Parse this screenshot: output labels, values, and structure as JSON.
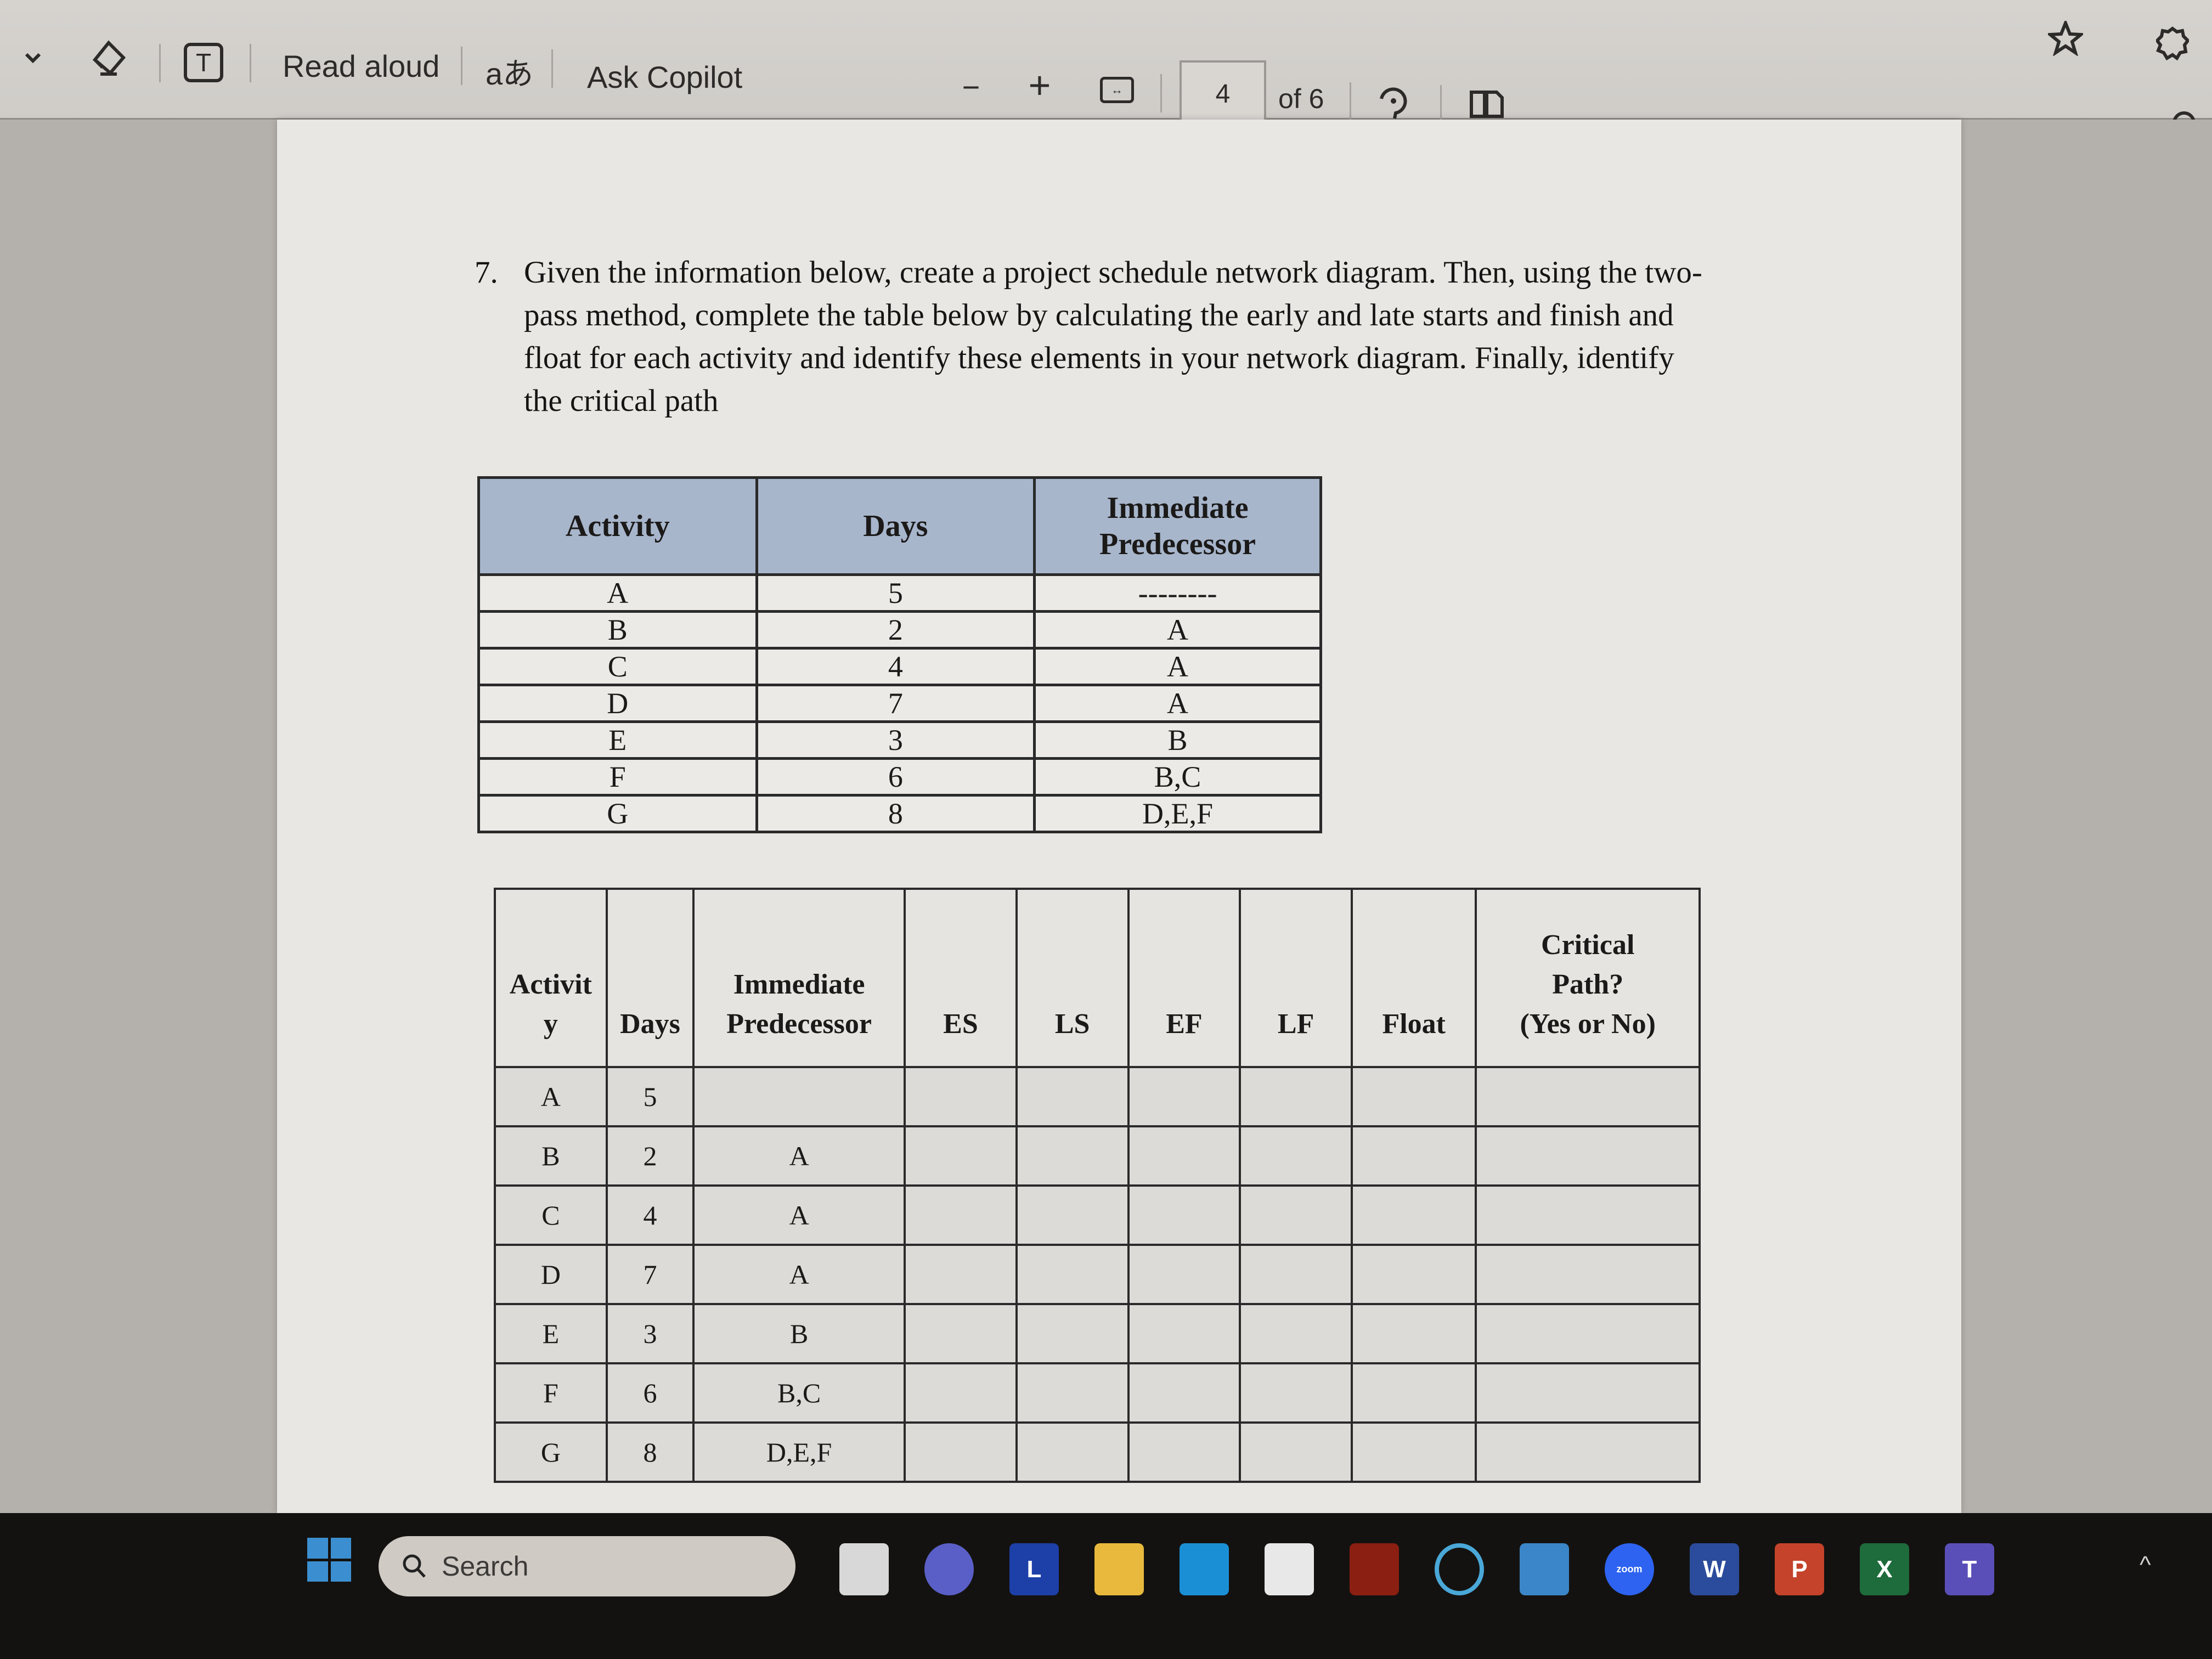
{
  "toolbar": {
    "dropdown_icon": "chevron-down-icon",
    "draw_icon": "eraser-icon",
    "text_icon": "text-box-icon",
    "read_aloud_label": "Read aloud",
    "translate_label": "aあ",
    "ask_copilot_label": "Ask Copilot",
    "zoom_out_label": "−",
    "zoom_in_label": "+",
    "fit_icon": "fit-width-icon",
    "current_page": "4",
    "page_count_label": "of 6",
    "rotate_icon": "rotate-icon",
    "page_view_icon": "two-page-view-icon",
    "favorite_icon": "star-icon",
    "extensions_icon": "puzzle-gear-icon",
    "find_icon": "search-icon"
  },
  "document": {
    "question_number": "7.",
    "question_text": "Given the information below, create a project schedule network diagram. Then, using the two-pass method, complete the table below by calculating the early and late starts and finish and float for each activity and identify these elements in your network diagram. Finally, identify the critical path",
    "table1": {
      "headers": [
        "Activity",
        "Days",
        "Immediate Predecessor"
      ],
      "rows": [
        [
          "A",
          "5",
          "--------"
        ],
        [
          "B",
          "2",
          "A"
        ],
        [
          "C",
          "4",
          "A"
        ],
        [
          "D",
          "7",
          "A"
        ],
        [
          "E",
          "3",
          "B"
        ],
        [
          "F",
          "6",
          "B,C"
        ],
        [
          "G",
          "8",
          "D,E,F"
        ]
      ]
    },
    "table2": {
      "headers": [
        "Activit y",
        "Days",
        "Immediate Predecessor",
        "ES",
        "LS",
        "EF",
        "LF",
        "Float",
        "Critical Path? (Yes or No)"
      ],
      "header_activity_line1": "Activit",
      "header_activity_line2": "y",
      "header_pred_line1": "Immediate",
      "header_pred_line2": "Predecessor",
      "header_cp_line1": "Critical",
      "header_cp_line2": "Path?",
      "header_cp_line3": "(Yes or No)",
      "rows": [
        [
          "A",
          "5",
          "",
          "",
          "",
          "",
          "",
          "",
          ""
        ],
        [
          "B",
          "2",
          "A",
          "",
          "",
          "",
          "",
          "",
          ""
        ],
        [
          "C",
          "4",
          "A",
          "",
          "",
          "",
          "",
          "",
          ""
        ],
        [
          "D",
          "7",
          "A",
          "",
          "",
          "",
          "",
          "",
          ""
        ],
        [
          "E",
          "3",
          "B",
          "",
          "",
          "",
          "",
          "",
          ""
        ],
        [
          "F",
          "6",
          "B,C",
          "",
          "",
          "",
          "",
          "",
          ""
        ],
        [
          "G",
          "8",
          "D,E,F",
          "",
          "",
          "",
          "",
          "",
          ""
        ]
      ]
    }
  },
  "taskbar": {
    "start_icon": "windows-start-icon",
    "search_placeholder": "Search",
    "apps": [
      {
        "name": "task-view-icon",
        "label": "",
        "color": "#d8d8d8"
      },
      {
        "name": "meet-video-icon",
        "label": "",
        "color": "#5a5fc7"
      },
      {
        "name": "l-app-icon",
        "label": "L",
        "color": "#1d3fa8"
      },
      {
        "name": "file-explorer-icon",
        "label": "",
        "color": "#e8b93c"
      },
      {
        "name": "edge-icon",
        "label": "",
        "color": "#1b8fd6"
      },
      {
        "name": "store-icon",
        "label": "",
        "color": "#e8e8e8"
      },
      {
        "name": "red-app-icon",
        "label": "",
        "color": "#8b1f12"
      },
      {
        "name": "cortana-icon",
        "label": "",
        "color": "#4aa8d8"
      },
      {
        "name": "mail-icon",
        "label": "",
        "color": "#3b86c8"
      },
      {
        "name": "zoom-icon",
        "label": "zoom",
        "color": "#2d63f0"
      },
      {
        "name": "word-icon",
        "label": "W",
        "color": "#2b4c9c"
      },
      {
        "name": "powerpoint-icon",
        "label": "P",
        "color": "#c4432a"
      },
      {
        "name": "excel-icon",
        "label": "X",
        "color": "#1e6b3c"
      },
      {
        "name": "teams-icon",
        "label": "T",
        "color": "#5a4fb8"
      }
    ],
    "tray_chevron": "^"
  }
}
